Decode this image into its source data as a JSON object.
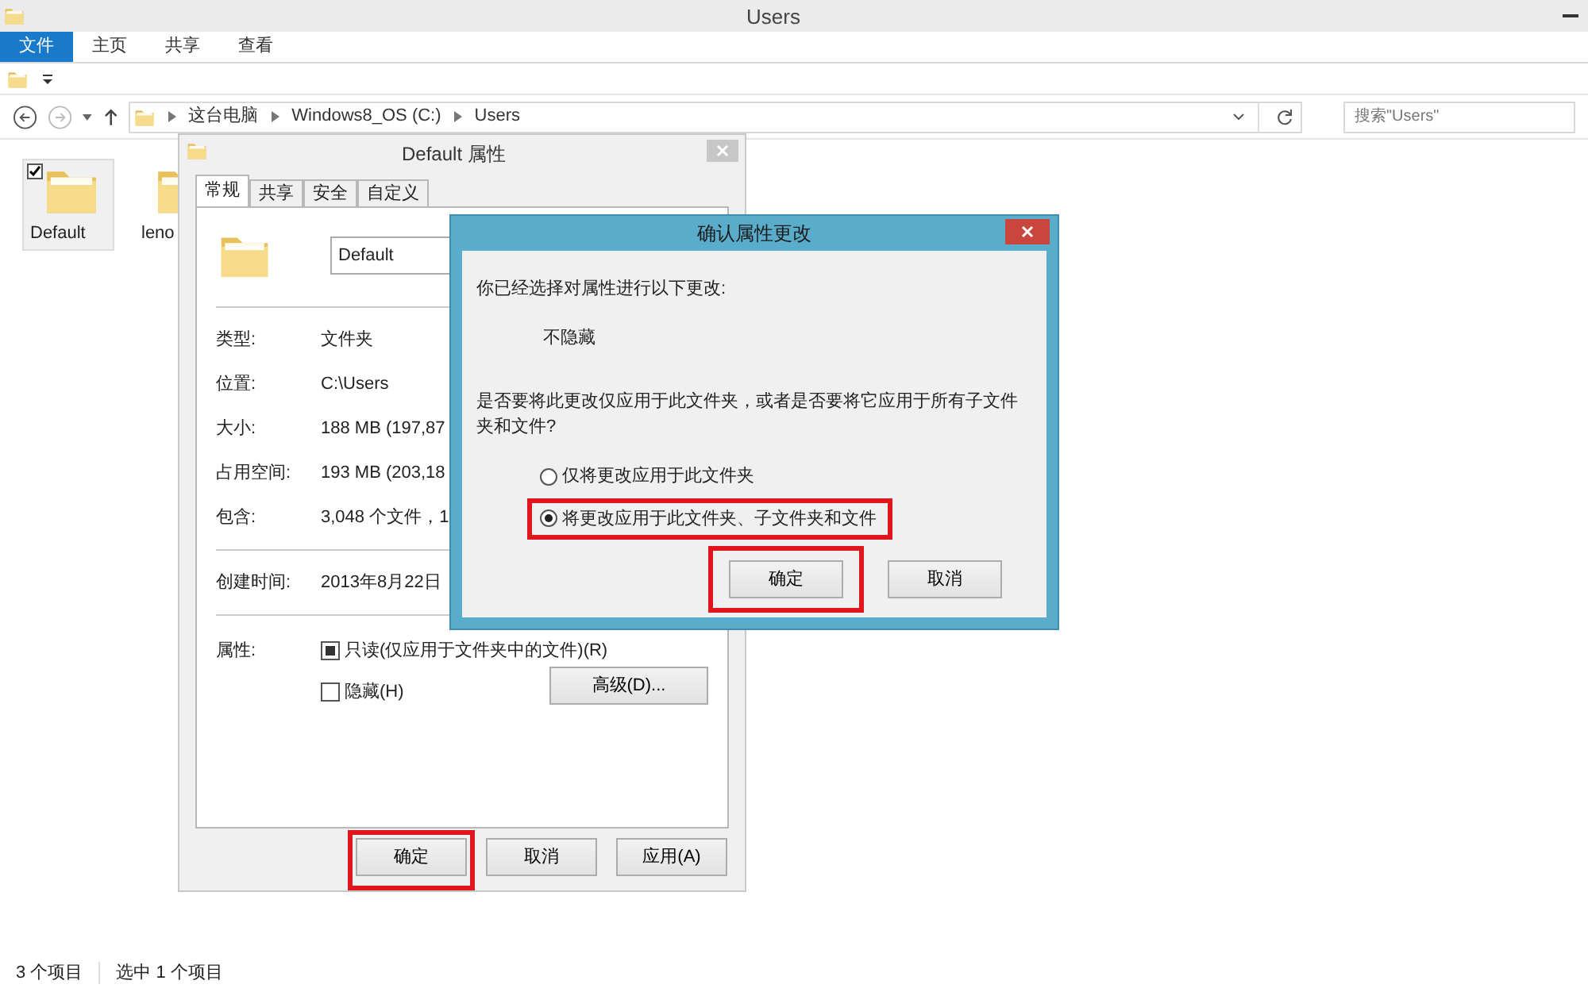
{
  "window": {
    "title": "Users"
  },
  "ribbon_tabs": [
    {
      "label": "文件",
      "selected": true
    },
    {
      "label": "主页",
      "selected": false
    },
    {
      "label": "共享",
      "selected": false
    },
    {
      "label": "查看",
      "selected": false
    }
  ],
  "nav": {
    "breadcrumb": [
      "这台电脑",
      "Windows8_OS (C:)",
      "Users"
    ],
    "search": {
      "placeholder": "搜索\"Users\""
    }
  },
  "files": [
    {
      "name": "Default",
      "selected": true
    },
    {
      "name": "leno",
      "selected": false
    }
  ],
  "status_bar": [
    "3 个项目",
    "选中 1 个项目"
  ],
  "properties_dialog": {
    "title": "Default 属性",
    "tabs": [
      {
        "label": "常规",
        "selected": true
      },
      {
        "label": "共享",
        "selected": false
      },
      {
        "label": "安全",
        "selected": false
      },
      {
        "label": "自定义",
        "selected": false
      }
    ],
    "name_value": "Default",
    "sections": [
      {
        "rows": [
          {
            "label": "类型:",
            "value": "文件夹"
          },
          {
            "label": "位置:",
            "value": "C:\\Users"
          },
          {
            "label": "大小:",
            "value": "188 MB (197,87"
          },
          {
            "label": "占用空间:",
            "value": "193 MB (203,18"
          },
          {
            "label": "包含:",
            "value": "3,048 个文件，1"
          }
        ]
      },
      {
        "rows": [
          {
            "label": "创建时间:",
            "value": "2013年8月22日"
          }
        ]
      }
    ],
    "attributes_label": "属性:",
    "attributes": [
      {
        "label": "只读(仅应用于文件夹中的文件)(R)",
        "checked": false,
        "indeterminate": true
      },
      {
        "label": "隐藏(H)",
        "checked": false,
        "indeterminate": false
      }
    ],
    "advanced_button": "高级(D)...",
    "buttons": [
      {
        "label": "确定",
        "highlighted": true
      },
      {
        "label": "取消",
        "highlighted": false
      },
      {
        "label": "应用(A)",
        "highlighted": false
      }
    ]
  },
  "confirm_dialog": {
    "title": "确认属性更改",
    "intro": "你已经选择对属性进行以下更改:",
    "change": "不隐藏",
    "question": "是否要将此更改仅应用于此文件夹，或者是否要将它应用于所有子文件夹和文件?",
    "options": [
      {
        "label": "仅将更改应用于此文件夹",
        "selected": false,
        "highlighted": false
      },
      {
        "label": "将更改应用于此文件夹、子文件夹和文件",
        "selected": true,
        "highlighted": true
      }
    ],
    "buttons": [
      {
        "label": "确定",
        "highlighted": true
      },
      {
        "label": "取消",
        "highlighted": false
      }
    ]
  }
}
